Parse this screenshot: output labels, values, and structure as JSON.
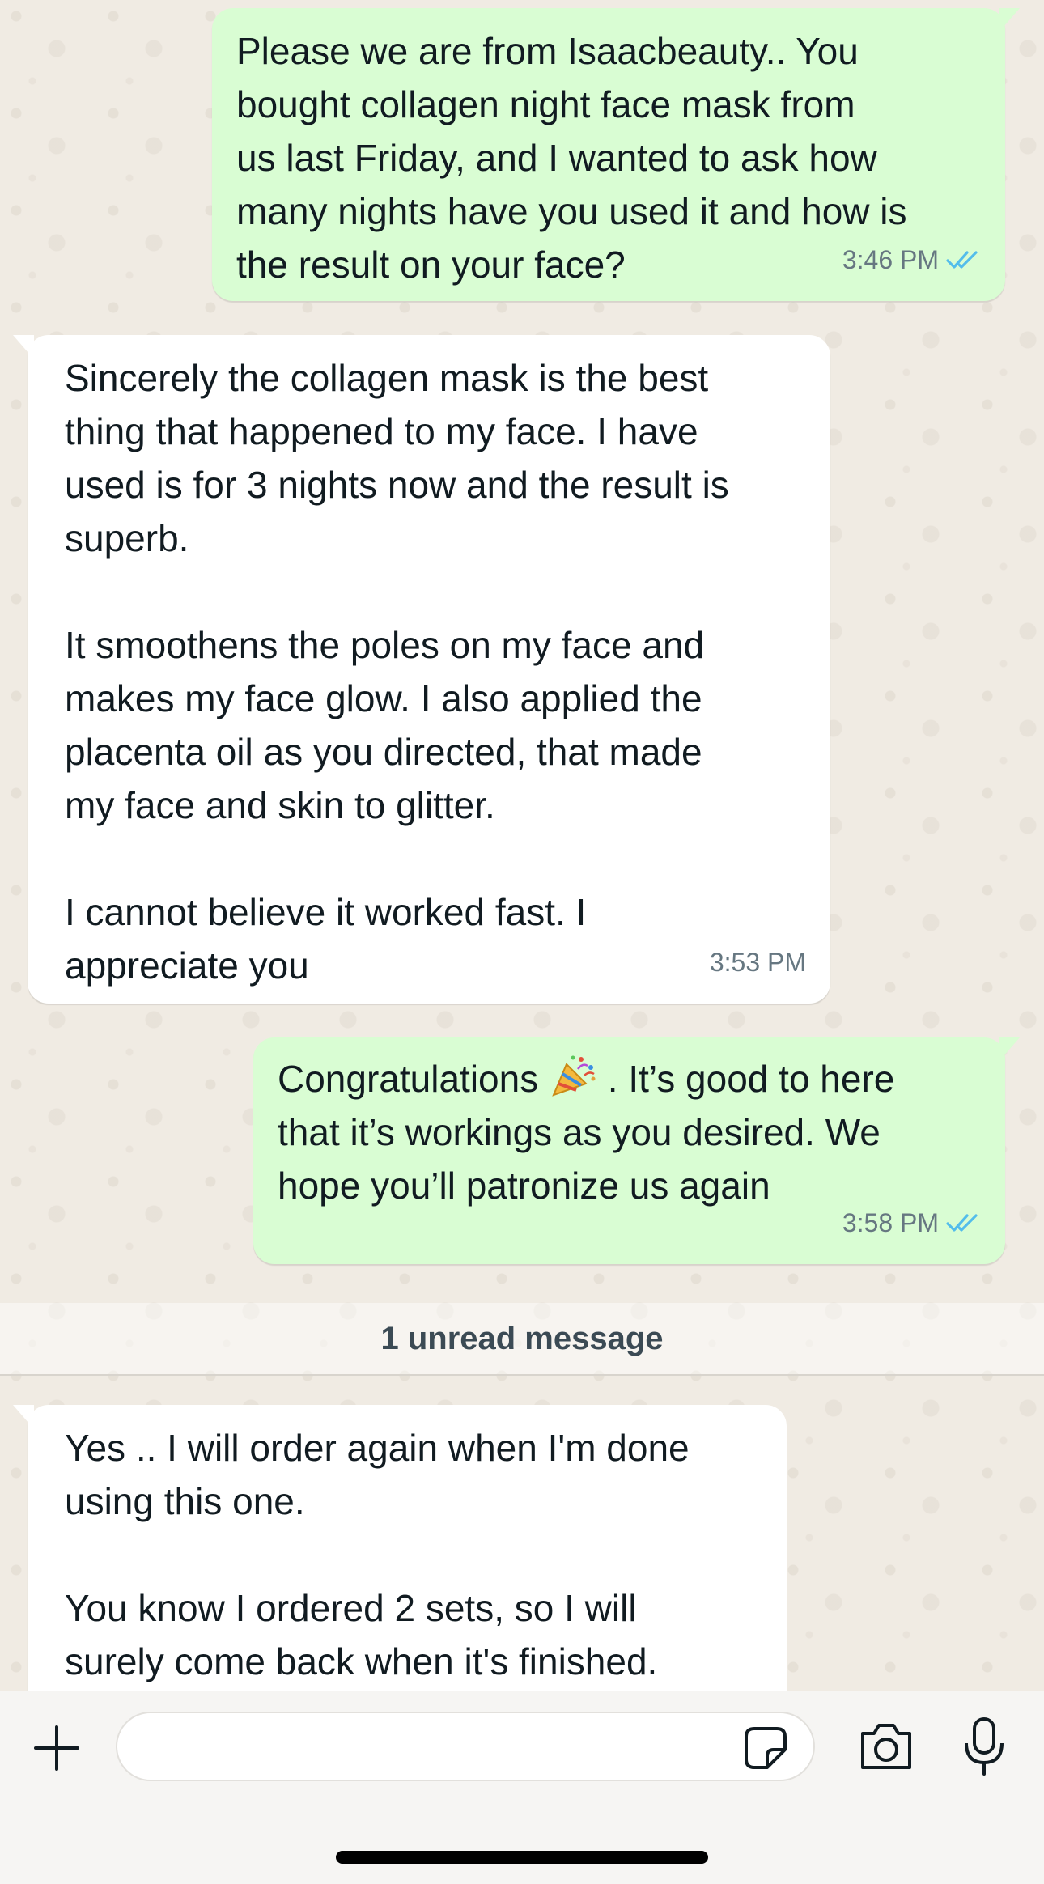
{
  "messages": [
    {
      "direction": "outgoing",
      "text": "Please we are from Isaacbeauty.. You\nbought collagen night face mask from\nus last Friday, and I wanted to ask how\nmany nights have you used it and how is\nthe result on your face?",
      "time": "3:46 PM",
      "status": "read"
    },
    {
      "direction": "incoming",
      "text": "Sincerely the collagen mask is the best\nthing that happened to my face. I have\nused is for 3 nights now and the result is\nsuperb.\n\nIt smoothens the poles on my face and\nmakes my face glow. I also applied the\nplacenta oil as you directed, that made\nmy face and skin to glitter.\n\nI cannot believe it worked fast. I\nappreciate you",
      "time": "3:53 PM"
    },
    {
      "direction": "outgoing",
      "text_before_emoji": "Congratulations ",
      "emoji": "party-popper-icon",
      "text_after_emoji": " . It’s good to here\nthat it’s workings as you desired. We\nhope you’ll patronize us again",
      "time": "3:58 PM",
      "status": "read"
    },
    {
      "direction": "incoming",
      "text": "Yes .. I will order again when I'm done\nusing this one.\n\nYou know I ordered 2 sets, so I will\nsurely come back when it's finished."
    }
  ],
  "unread_banner": "1 unread message",
  "composer": {
    "input_value": "",
    "icons": [
      "plus-icon",
      "sticker-icon",
      "camera-icon",
      "microphone-icon"
    ]
  },
  "colors": {
    "outgoing_bubble": "#d9fdd3",
    "incoming_bubble": "#ffffff",
    "read_ticks": "#53bdeb",
    "wallpaper": "#efeae2"
  }
}
